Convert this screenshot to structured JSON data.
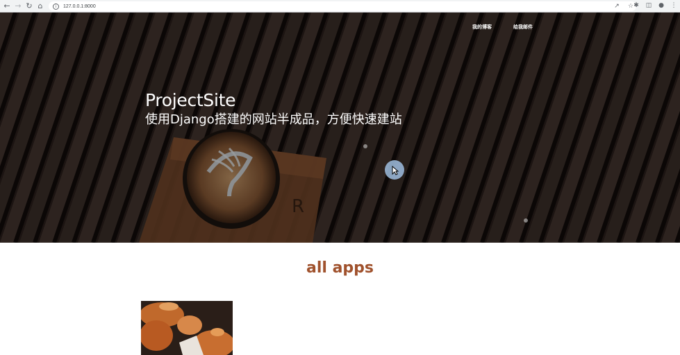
{
  "browser": {
    "url": "127.0.0.1:8000",
    "icons": [
      "back-arrow",
      "forward-arrow",
      "reload",
      "home",
      "site-info",
      "share",
      "bookmark-star",
      "extensions",
      "side-panel",
      "profile",
      "menu"
    ]
  },
  "nav": {
    "items": [
      {
        "label": "我的博客"
      },
      {
        "label": "给我邮件"
      }
    ]
  },
  "hero": {
    "title": "ProjectSite",
    "subtitle": "使用Django搭建的网站半成品，方便快速建站"
  },
  "section": {
    "title": "all apps"
  },
  "colors": {
    "accent": "#a0522d",
    "hero_overlay": "#2a1f1c",
    "cursor": "#a0bee1"
  }
}
